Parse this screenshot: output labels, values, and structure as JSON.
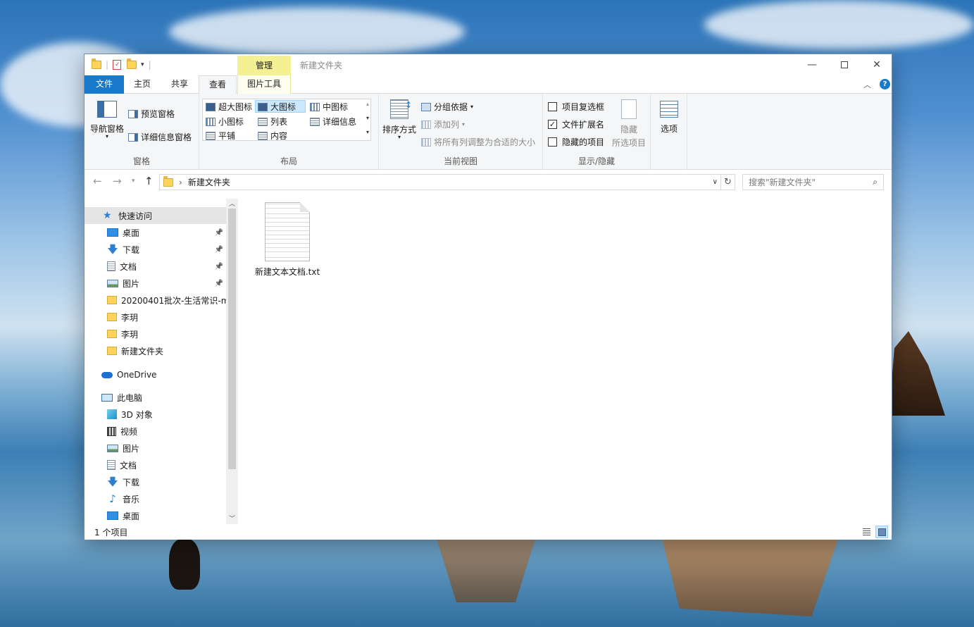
{
  "window": {
    "title": "新建文件夹",
    "context_tab_group": "管理"
  },
  "tabs": {
    "file": "文件",
    "home": "主页",
    "share": "共享",
    "view": "查看",
    "picture_tools": "图片工具"
  },
  "ribbon": {
    "panes": {
      "nav_pane": "导航窗格",
      "preview_pane": "预览窗格",
      "details_pane": "详细信息窗格",
      "group_label": "窗格"
    },
    "layout": {
      "extra_large": "超大图标",
      "large": "大图标",
      "medium": "中图标",
      "small": "小图标",
      "list": "列表",
      "details": "详细信息",
      "tiles": "平铺",
      "content": "内容",
      "group_label": "布局",
      "selected": "大图标"
    },
    "current_view": {
      "sort_by": "排序方式",
      "group_by": "分组依据",
      "add_columns": "添加列",
      "size_all_columns": "将所有列调整为合适的大小",
      "group_label": "当前视图"
    },
    "show_hide": {
      "item_checkboxes": "项目复选框",
      "item_checkboxes_checked": false,
      "file_extensions": "文件扩展名",
      "file_extensions_checked": true,
      "hidden_items": "隐藏的项目",
      "hidden_items_checked": false,
      "hide_selected_line1": "隐藏",
      "hide_selected_line2": "所选项目",
      "group_label": "显示/隐藏"
    },
    "options": "选项"
  },
  "address": {
    "path": "新建文件夹",
    "search_placeholder": "搜索\"新建文件夹\""
  },
  "nav": {
    "quick_access": "快速访问",
    "qa_items": [
      {
        "label": "桌面",
        "icon": "desktop-icon",
        "pinned": true
      },
      {
        "label": "下载",
        "icon": "download-icon",
        "pinned": true
      },
      {
        "label": "文档",
        "icon": "document-icon",
        "pinned": true
      },
      {
        "label": "图片",
        "icon": "picture-icon",
        "pinned": true
      },
      {
        "label": "20200401批次-生活常识-m",
        "icon": "folder-icon",
        "pinned": false
      },
      {
        "label": "李玥",
        "icon": "folder-icon",
        "pinned": false
      },
      {
        "label": "李玥",
        "icon": "folder-icon",
        "pinned": false
      },
      {
        "label": "新建文件夹",
        "icon": "folder-icon",
        "pinned": false
      }
    ],
    "onedrive": "OneDrive",
    "this_pc": "此电脑",
    "pc_items": [
      {
        "label": "3D 对象",
        "icon": "3d-objects-icon"
      },
      {
        "label": "视频",
        "icon": "video-icon"
      },
      {
        "label": "图片",
        "icon": "picture-icon"
      },
      {
        "label": "文档",
        "icon": "document-icon"
      },
      {
        "label": "下载",
        "icon": "download-icon"
      },
      {
        "label": "音乐",
        "icon": "music-icon"
      },
      {
        "label": "桌面",
        "icon": "desktop-icon"
      }
    ]
  },
  "files": [
    {
      "name": "新建文本文档.txt",
      "icon": "text-file-icon"
    }
  ],
  "status": {
    "count": "1 个项目"
  },
  "colors": {
    "file_tab": "#1979ca",
    "context_tab": "#f4f195",
    "selection": "#cce8ff"
  }
}
